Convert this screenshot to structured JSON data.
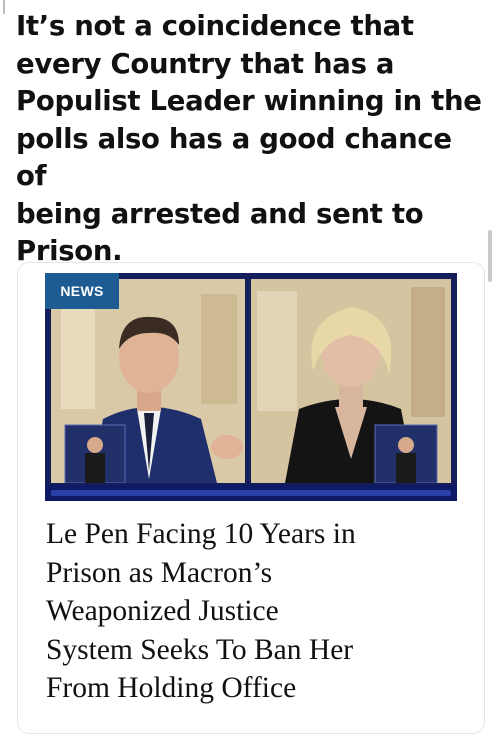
{
  "post": {
    "text": "It’s not a coincidence that\nevery Country that has a\nPopulist Leader winning in the\npolls also has a good chance of\nbeing arrested and sent to\nPrison."
  },
  "card": {
    "badge": "NEWS",
    "headline": "Le Pen Facing 10 Years in\nPrison as Macron’s\nWeaponized Justice\nSystem Seeks To Ban Her\nFrom Holding Office"
  },
  "colors": {
    "badge_bg": "#1c5c92",
    "frame": "#141e5a",
    "text": "#111111"
  }
}
